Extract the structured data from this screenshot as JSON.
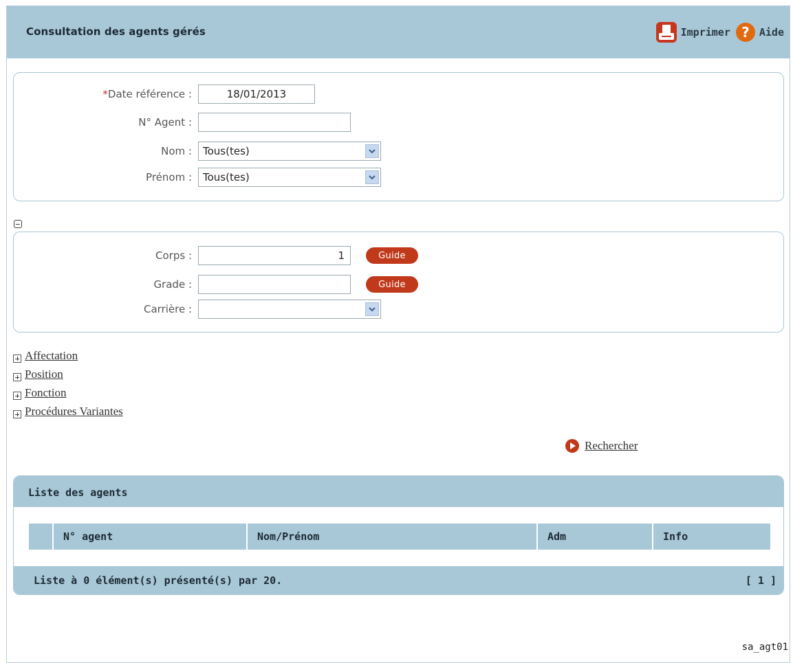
{
  "header": {
    "title": "Consultation des agents gérés",
    "print_label": "Imprimer",
    "help_label": "Aide",
    "help_glyph": "?"
  },
  "criteria": {
    "required_mark": "*",
    "date_label": "Date référence :",
    "date_value": "18/01/2013",
    "agent_no_label": "N° Agent :",
    "agent_no_value": "",
    "nom_label": "Nom :",
    "nom_value": "Tous(tes)",
    "prenom_label": "Prénom :",
    "prenom_value": "Tous(tes)"
  },
  "corps_section": {
    "corps_label": "Corps :",
    "corps_value": "1",
    "grade_label": "Grade :",
    "grade_value": "",
    "carriere_label": "Carrière :",
    "carriere_value": "",
    "guide_label": "Guide"
  },
  "sections": [
    {
      "label": "Affectation"
    },
    {
      "label": "Position"
    },
    {
      "label": "Fonction"
    },
    {
      "label": "Procédures Variantes"
    }
  ],
  "search": {
    "label": "Rechercher"
  },
  "list": {
    "title": "Liste des agents",
    "columns": [
      "",
      "N° agent",
      "Nom/Prénom",
      "Adm",
      "Info"
    ],
    "rows": [],
    "footer": "Liste à 0 élément(s) présenté(s) par 20.",
    "pager": "[ 1 ]"
  },
  "screen_code": "sa_agt01",
  "colors": {
    "header_bg": "#a8c8d8",
    "accent_red": "#c0391a",
    "help_orange": "#e06a10",
    "required": "#c4272a"
  },
  "icons": {
    "print": "print-icon",
    "help": "help-icon",
    "collapse": "minus-box-icon",
    "expand": "plus-box-icon",
    "search": "play-circle-icon",
    "dropdown": "chevron-down-icon"
  }
}
